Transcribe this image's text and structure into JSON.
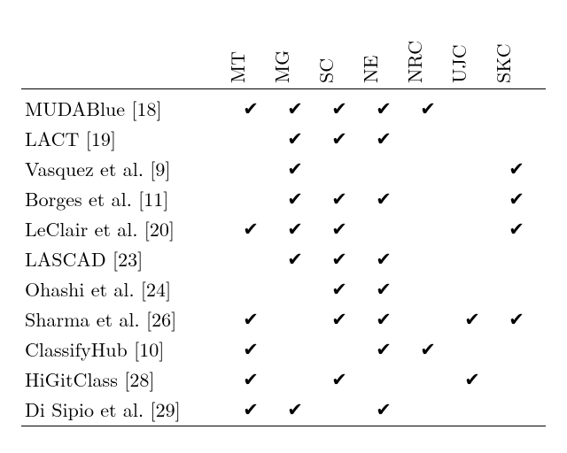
{
  "chart_data": {
    "type": "table",
    "columns": [
      "MT",
      "MG",
      "SC",
      "NE",
      "NRC",
      "UJC",
      "SKC"
    ],
    "rows": [
      {
        "label": "MUDABlue [18]",
        "marks": [
          true,
          true,
          true,
          true,
          true,
          false,
          false
        ]
      },
      {
        "label": "LACT [19]",
        "marks": [
          false,
          true,
          true,
          true,
          false,
          false,
          false
        ]
      },
      {
        "label": "Vasquez et al. [9]",
        "marks": [
          false,
          true,
          false,
          false,
          false,
          false,
          true
        ]
      },
      {
        "label": "Borges et al. [11]",
        "marks": [
          false,
          true,
          true,
          true,
          false,
          false,
          true
        ]
      },
      {
        "label": "LeClair et al. [20]",
        "marks": [
          true,
          true,
          true,
          false,
          false,
          false,
          true
        ]
      },
      {
        "label": "LASCAD [23]",
        "marks": [
          false,
          true,
          true,
          true,
          false,
          false,
          false
        ]
      },
      {
        "label": "Ohashi et al. [24]",
        "marks": [
          false,
          false,
          true,
          true,
          false,
          false,
          false
        ]
      },
      {
        "label": "Sharma et al. [26]",
        "marks": [
          true,
          false,
          true,
          true,
          false,
          true,
          true
        ]
      },
      {
        "label": "ClassifyHub [10]",
        "marks": [
          true,
          false,
          false,
          true,
          true,
          false,
          false
        ]
      },
      {
        "label": "HiGitClass [28]",
        "marks": [
          true,
          false,
          true,
          false,
          false,
          true,
          false
        ]
      },
      {
        "label": "Di Sipio et al. [29]",
        "marks": [
          true,
          true,
          false,
          true,
          false,
          false,
          false
        ]
      }
    ],
    "check_glyph": "✔"
  }
}
